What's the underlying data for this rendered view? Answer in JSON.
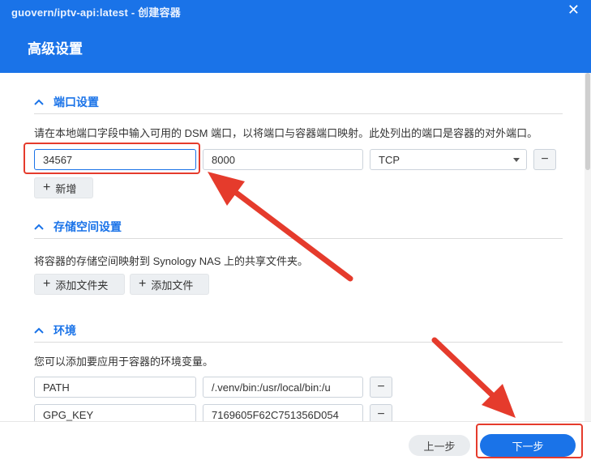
{
  "window": {
    "title": "guovern/iptv-api:latest - 创建容器",
    "heading": "高级设置"
  },
  "sections": {
    "ports": {
      "title": "端口设置",
      "description": "请在本地端口字段中输入可用的 DSM 端口，以将端口与容器端口映射。此处列出的端口是容器的对外端口。",
      "local_port": "34567",
      "container_port": "8000",
      "protocol": "TCP",
      "add_label": "新增"
    },
    "storage": {
      "title": "存储空间设置",
      "description": "将容器的存储空间映射到 Synology NAS 上的共享文件夹。",
      "add_folder_label": "添加文件夹",
      "add_file_label": "添加文件"
    },
    "env": {
      "title": "环境",
      "description": "您可以添加要应用于容器的环境变量。",
      "rows": [
        {
          "key": "PATH",
          "value": "/.venv/bin:/usr/local/bin:/u"
        },
        {
          "key": "GPG_KEY",
          "value": "7169605F62C751356D054"
        }
      ]
    }
  },
  "footer": {
    "prev_label": "上一步",
    "next_label": "下一步"
  },
  "colors": {
    "accent": "#1a73e8",
    "annotation": "#e53b2c"
  }
}
